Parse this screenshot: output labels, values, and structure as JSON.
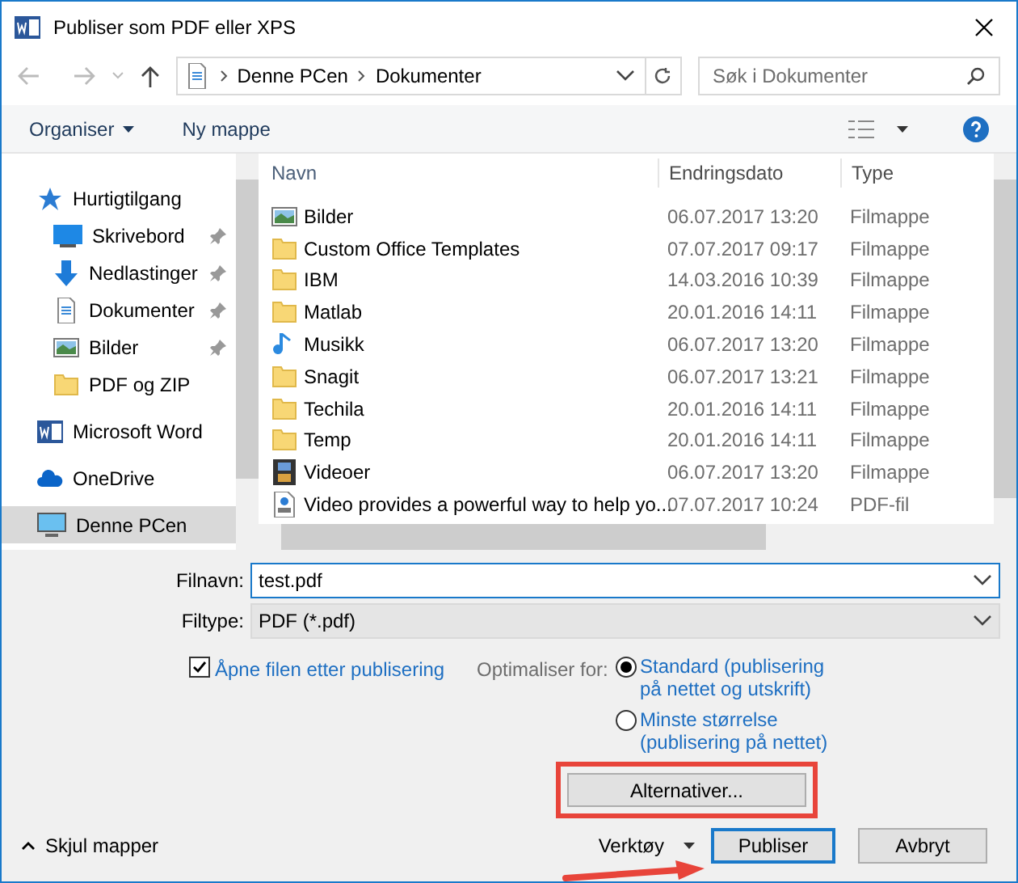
{
  "window": {
    "title": "Publiser som PDF eller XPS"
  },
  "nav": {
    "path": [
      "Denne PCen",
      "Dokumenter"
    ],
    "search_placeholder": "Søk i Dokumenter"
  },
  "toolbar": {
    "organize": "Organiser",
    "new_folder": "Ny mappe"
  },
  "sidebar": {
    "items": [
      {
        "label": "Hurtigtilgang",
        "kind": "star",
        "selected": false,
        "children": [
          {
            "label": "Skrivebord",
            "kind": "desktop",
            "pinned": true,
            "selected": false
          },
          {
            "label": "Nedlastinger",
            "kind": "download",
            "pinned": true,
            "selected": false
          },
          {
            "label": "Dokumenter",
            "kind": "document",
            "pinned": true,
            "selected": false
          },
          {
            "label": "Bilder",
            "kind": "picture",
            "pinned": true,
            "selected": false
          },
          {
            "label": "PDF og ZIP",
            "kind": "folder",
            "pinned": false,
            "selected": false
          }
        ]
      },
      {
        "label": "Microsoft Word",
        "kind": "word",
        "selected": false
      },
      {
        "label": "OneDrive",
        "kind": "cloud",
        "selected": false
      },
      {
        "label": "Denne PCen",
        "kind": "pc",
        "selected": true
      }
    ]
  },
  "table": {
    "columns": [
      "Navn",
      "Endringsdato",
      "Type"
    ],
    "rows": [
      {
        "name": "Bilder",
        "kind": "picture",
        "date": "06.07.2017 13:20",
        "type": "Filmappe"
      },
      {
        "name": "Custom Office Templates",
        "kind": "folder",
        "date": "07.07.2017 09:17",
        "type": "Filmappe"
      },
      {
        "name": "IBM",
        "kind": "folder",
        "date": "14.03.2016 10:39",
        "type": "Filmappe"
      },
      {
        "name": "Matlab",
        "kind": "folder",
        "date": "20.01.2016 14:11",
        "type": "Filmappe"
      },
      {
        "name": "Musikk",
        "kind": "music",
        "date": "06.07.2017 13:20",
        "type": "Filmappe"
      },
      {
        "name": "Snagit",
        "kind": "folder",
        "date": "06.07.2017 13:21",
        "type": "Filmappe"
      },
      {
        "name": "Techila",
        "kind": "folder",
        "date": "20.01.2016 14:11",
        "type": "Filmappe"
      },
      {
        "name": "Temp",
        "kind": "folder",
        "date": "20.01.2016 14:11",
        "type": "Filmappe"
      },
      {
        "name": "Videoer",
        "kind": "video",
        "date": "06.07.2017 13:20",
        "type": "Filmappe"
      },
      {
        "name": "Video provides a powerful way to help yo...",
        "kind": "pdf",
        "date": "07.07.2017 10:24",
        "type": "PDF-fil"
      }
    ]
  },
  "form": {
    "filename_label": "Filnavn:",
    "filename": "test.pdf",
    "filetype_label": "Filtype:",
    "filetype": "PDF (*.pdf)",
    "open_after": {
      "label": "Åpne filen etter publisering",
      "checked": true
    },
    "optimize_label": "Optimaliser for:",
    "optimize_options": [
      {
        "label": "Standard (publisering på nettet og utskrift)",
        "selected": true
      },
      {
        "label": "Minste størrelse (publisering på nettet)",
        "selected": false
      }
    ],
    "options_button": "Alternativer..."
  },
  "footer": {
    "hide_folders": "Skjul mapper",
    "tools": "Verktøy",
    "publish": "Publiser",
    "cancel": "Avbryt"
  }
}
